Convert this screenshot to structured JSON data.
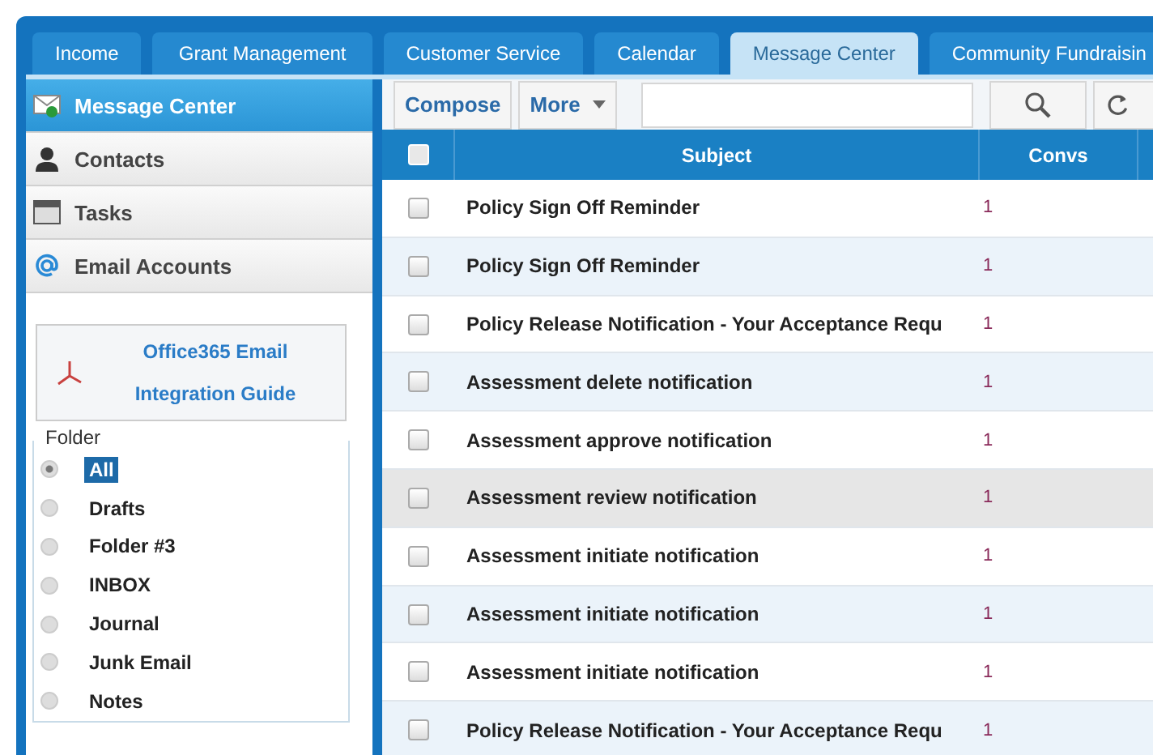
{
  "tabs": [
    {
      "label": "Income",
      "selected": false
    },
    {
      "label": "Grant Management",
      "selected": false
    },
    {
      "label": "Customer Service",
      "selected": false
    },
    {
      "label": "Calendar",
      "selected": false
    },
    {
      "label": "Message Center",
      "selected": true
    },
    {
      "label": "Community Fundraisin",
      "selected": false
    }
  ],
  "sidebar": {
    "items": [
      {
        "label": "Message Center",
        "kind": "mail",
        "selected": true
      },
      {
        "label": "Contacts",
        "kind": "contacts",
        "selected": false
      },
      {
        "label": "Tasks",
        "kind": "tasks",
        "selected": false
      },
      {
        "label": "Email Accounts",
        "kind": "at",
        "selected": false
      }
    ],
    "guide": [
      "Office365 Email",
      "Integration Guide"
    ],
    "folder_title": "Folder",
    "folders": [
      {
        "label": "All",
        "selected": true
      },
      {
        "label": "Drafts",
        "selected": false
      },
      {
        "label": "Folder #3",
        "selected": false
      },
      {
        "label": "INBOX",
        "selected": false
      },
      {
        "label": "Journal",
        "selected": false
      },
      {
        "label": "Junk Email",
        "selected": false
      },
      {
        "label": "Notes",
        "selected": false
      }
    ]
  },
  "toolbar": {
    "compose": "Compose",
    "more": "More"
  },
  "table": {
    "columns": [
      "Subject",
      "Convs"
    ],
    "select_all": {
      "checked": false
    },
    "rows": [
      {
        "subject": "Policy Sign Off Reminder",
        "convs": "1",
        "checked": false,
        "highlighted": false
      },
      {
        "subject": "Policy Sign Off Reminder",
        "convs": "1",
        "checked": false,
        "highlighted": false
      },
      {
        "subject": "Policy Release Notification - Your Acceptance Requ",
        "convs": "1",
        "checked": false,
        "highlighted": false
      },
      {
        "subject": "Assessment delete notification",
        "convs": "1",
        "checked": false,
        "highlighted": false
      },
      {
        "subject": "Assessment approve notification",
        "convs": "1",
        "checked": false,
        "highlighted": false
      },
      {
        "subject": "Assessment review notification",
        "convs": "1",
        "checked": false,
        "highlighted": true
      },
      {
        "subject": "Assessment initiate notification",
        "convs": "1",
        "checked": false,
        "highlighted": false
      },
      {
        "subject": "Assessment initiate notification",
        "convs": "1",
        "checked": false,
        "highlighted": false
      },
      {
        "subject": "Assessment initiate notification",
        "convs": "1",
        "checked": false,
        "highlighted": false
      },
      {
        "subject": "Policy Release Notification - Your Acceptance Requ",
        "convs": "1",
        "checked": false,
        "highlighted": false
      }
    ]
  }
}
